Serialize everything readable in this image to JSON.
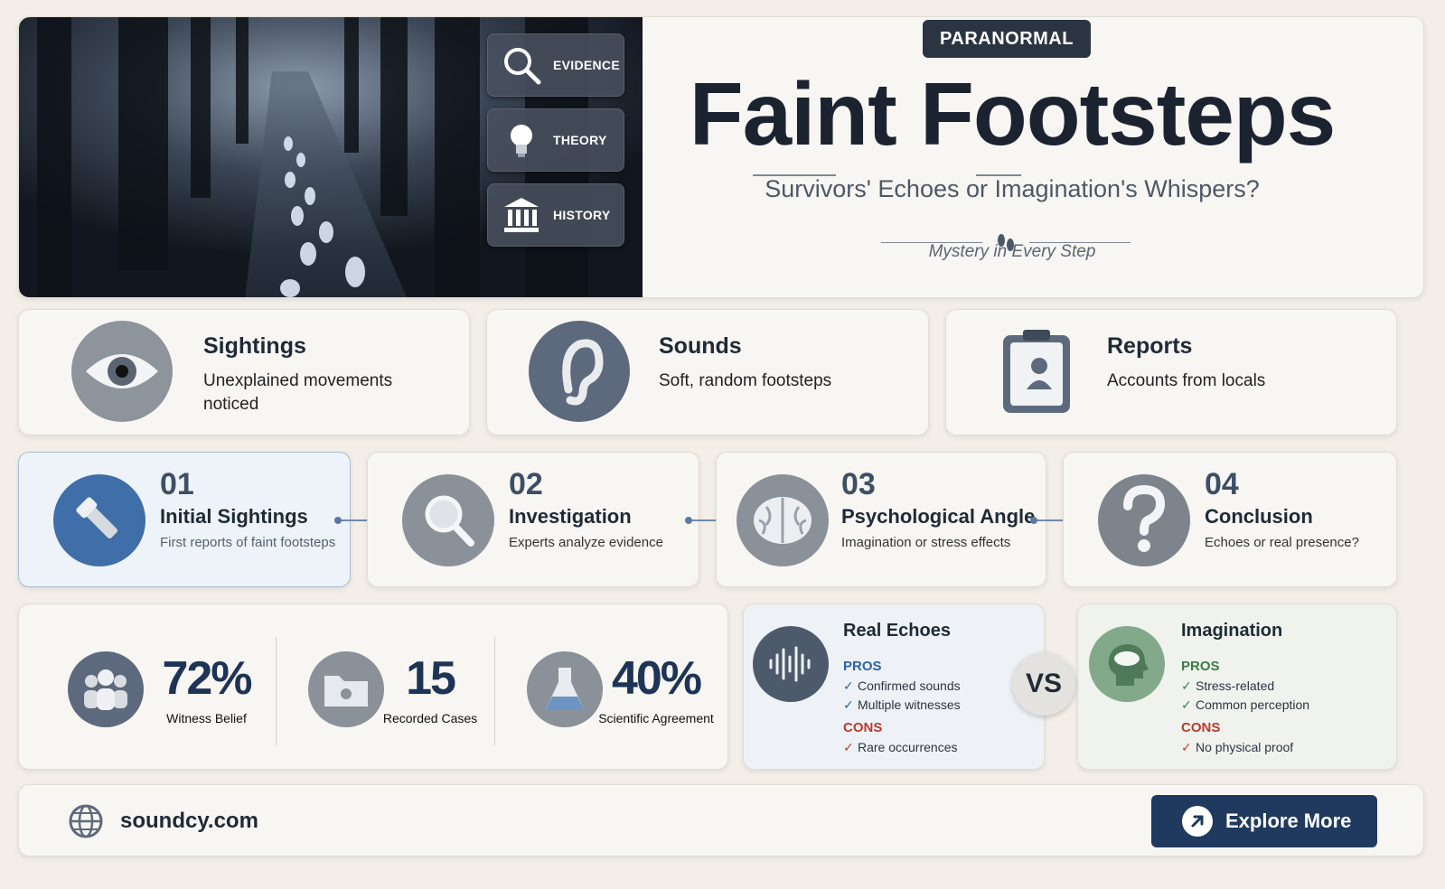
{
  "hero": {
    "side_buttons": [
      {
        "label": "EVIDENCE",
        "icon": "magnifier-icon"
      },
      {
        "label": "THEORY",
        "icon": "lightbulb-icon"
      },
      {
        "label": "HISTORY",
        "icon": "museum-icon"
      }
    ],
    "tag": "PARANORMAL",
    "title": "Faint Footsteps",
    "subtitle": "Survivors' Echoes or Imagination's Whispers?",
    "tagline": "Mystery in Every Step"
  },
  "features": [
    {
      "title": "Sightings",
      "desc": "Unexplained movements noticed",
      "icon": "eye-icon"
    },
    {
      "title": "Sounds",
      "desc": "Soft, random footsteps",
      "icon": "ear-icon"
    },
    {
      "title": "Reports",
      "desc": "Accounts from locals",
      "icon": "clipboard-icon"
    }
  ],
  "steps": [
    {
      "num": "01",
      "title": "Initial Sightings",
      "desc": "First reports of faint footsteps",
      "icon": "flashlight-icon"
    },
    {
      "num": "02",
      "title": "Investigation",
      "desc": "Experts analyze evidence",
      "icon": "magnifier-icon"
    },
    {
      "num": "03",
      "title": "Psychological Angle",
      "desc": "Imagination or stress effects",
      "icon": "brain-icon"
    },
    {
      "num": "04",
      "title": "Conclusion",
      "desc": "Echoes or real presence?",
      "icon": "question-icon"
    }
  ],
  "stats": [
    {
      "value": "72%",
      "label": "Witness Belief",
      "icon": "people-icon"
    },
    {
      "value": "15",
      "label": "Recorded Cases",
      "icon": "folder-icon"
    },
    {
      "value": "40%",
      "label": "Scientific Agreement",
      "icon": "flask-icon"
    }
  ],
  "compare": {
    "vs": "VS",
    "left": {
      "title": "Real Echoes",
      "pros_label": "PROS",
      "pros": [
        "Confirmed sounds",
        "Multiple witnesses"
      ],
      "cons_label": "CONS",
      "cons": [
        "Rare occurrences"
      ],
      "icon": "soundwave-icon"
    },
    "right": {
      "title": "Imagination",
      "pros_label": "PROS",
      "pros": [
        "Stress-related",
        "Common perception"
      ],
      "cons_label": "CONS",
      "cons": [
        "No physical proof"
      ],
      "icon": "head-cloud-icon"
    }
  },
  "footer": {
    "site": "soundcy.com",
    "button": "Explore More"
  },
  "colors": {
    "accent": "#1f3a5e",
    "pros_blue": "#2a63a8",
    "pros_green": "#3d7a45",
    "cons_red": "#c0392b"
  }
}
